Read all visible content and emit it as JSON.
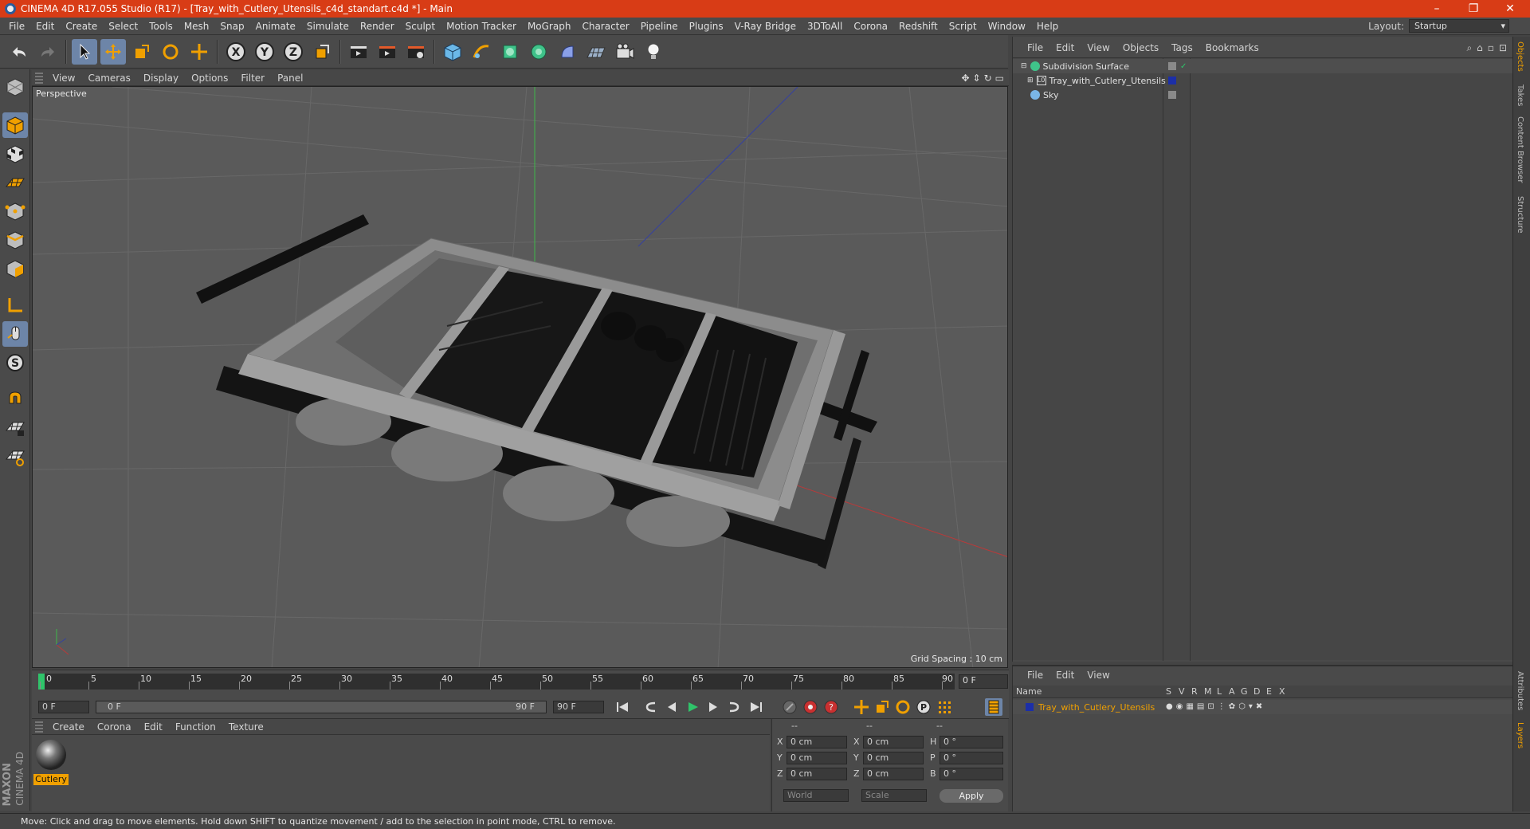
{
  "window": {
    "title": "CINEMA 4D R17.055 Studio (R17) - [Tray_with_Cutlery_Utensils_c4d_standart.c4d *] - Main",
    "minimize": "–",
    "maximize": "❐",
    "close": "✕"
  },
  "menubar": {
    "items": [
      "File",
      "Edit",
      "Create",
      "Select",
      "Tools",
      "Mesh",
      "Snap",
      "Animate",
      "Simulate",
      "Render",
      "Sculpt",
      "Motion Tracker",
      "MoGraph",
      "Character",
      "Pipeline",
      "Plugins",
      "V-Ray Bridge",
      "3DToAll",
      "Corona",
      "Redshift",
      "Script",
      "Window",
      "Help"
    ],
    "layout_label": "Layout:",
    "layout_value": "Startup"
  },
  "viewport": {
    "menu": [
      "View",
      "Cameras",
      "Display",
      "Options",
      "Filter",
      "Panel"
    ],
    "label": "Perspective",
    "grid_spacing": "Grid Spacing : 10 cm"
  },
  "timeline": {
    "ticks": [
      "0",
      "5",
      "10",
      "15",
      "20",
      "25",
      "30",
      "35",
      "40",
      "45",
      "50",
      "55",
      "60",
      "65",
      "70",
      "75",
      "80",
      "85",
      "90"
    ],
    "current_frame": "0 F",
    "start_field": "0 F",
    "range_start": "0 F",
    "range_end": "90 F",
    "end_field": "90 F"
  },
  "material": {
    "menu": [
      "Create",
      "Corona",
      "Edit",
      "Function",
      "Texture"
    ],
    "items": [
      {
        "name": "Cutlery"
      }
    ]
  },
  "coordinates": {
    "header": [
      "--",
      "--",
      "--"
    ],
    "rows": [
      {
        "a": "X",
        "av": "0 cm",
        "b": "X",
        "bv": "0 cm",
        "c": "H",
        "cv": "0 °"
      },
      {
        "a": "Y",
        "av": "0 cm",
        "b": "Y",
        "bv": "0 cm",
        "c": "P",
        "cv": "0 °"
      },
      {
        "a": "Z",
        "av": "0 cm",
        "b": "Z",
        "bv": "0 cm",
        "c": "B",
        "cv": "0 °"
      }
    ],
    "mode": "World",
    "size_mode": "Scale",
    "apply": "Apply"
  },
  "objects": {
    "menu": [
      "File",
      "Edit",
      "View",
      "Objects",
      "Tags",
      "Bookmarks"
    ],
    "items": [
      {
        "name": "Subdivision Surface"
      },
      {
        "name": "Tray_with_Cutlery_Utensils"
      },
      {
        "name": "Sky"
      }
    ]
  },
  "layers": {
    "menu": [
      "File",
      "Edit",
      "View"
    ],
    "columns": [
      "Name",
      "S",
      "V",
      "R",
      "M",
      "L",
      "A",
      "G",
      "D",
      "E",
      "X"
    ],
    "items": [
      {
        "name": "Tray_with_Cutlery_Utensils"
      }
    ]
  },
  "right_tabs": [
    "Objects",
    "Takes",
    "Content Browser",
    "Structure",
    "Attributes",
    "Layers"
  ],
  "branding": {
    "maxon": "MAXON",
    "c4d": "CINEMA 4D"
  },
  "status": "Move: Click and drag to move elements. Hold down SHIFT to quantize movement / add to the selection in point mode, CTRL to remove.",
  "colors": {
    "titlebar": "#d83c16",
    "accent": "#6d85a8",
    "selection": "#f0a000",
    "layer": "#1c2fa8"
  }
}
